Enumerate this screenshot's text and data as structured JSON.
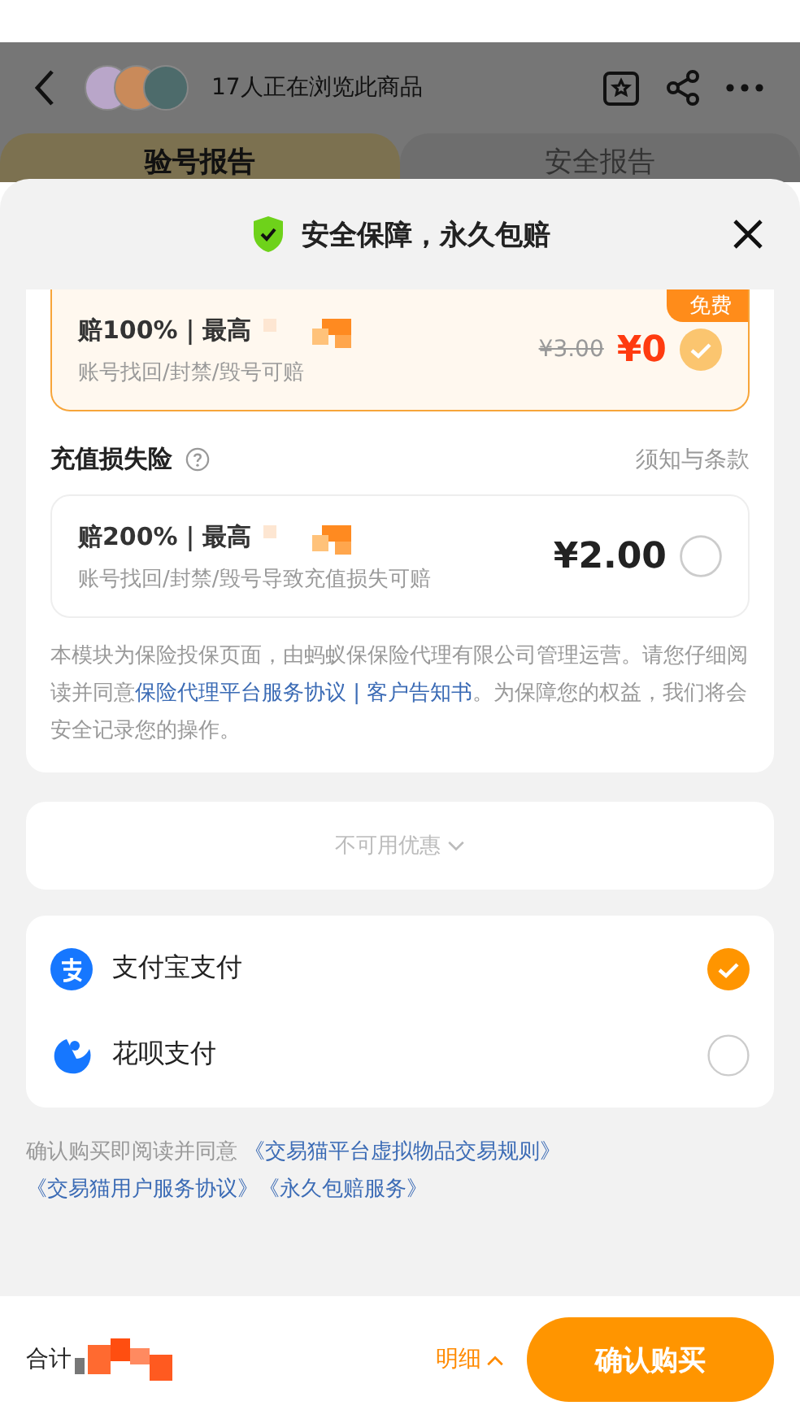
{
  "header": {
    "viewers": "17人正在浏览此商品"
  },
  "tabs": [
    {
      "label": "验号报告",
      "selected": true
    },
    {
      "label": "安全报告",
      "selected": false
    }
  ],
  "sheet": {
    "title": "安全保障，永久包赔"
  },
  "plans": [
    {
      "title": "赔100%｜最高",
      "desc": "账号找回/封禁/毁号可赔",
      "badge": "免费",
      "original_price": "¥3.00",
      "price": "¥0",
      "selected": true
    },
    {
      "title": "赔200%｜最高",
      "desc": "账号找回/封禁/毁号导致充值损失可赔",
      "price": "¥2.00",
      "selected": false
    }
  ],
  "section": {
    "title": "充值损失险",
    "terms_link": "须知与条款"
  },
  "notice": "本模块为保险投保页面，由蚂蚁保保险代理有限公司管理运营。请您仔细阅读并同意",
  "notice_link": "保险代理平台服务协议 | 客户告知书",
  "notice_tail": "。为保障您的权益，我们将会安全记录您的操作。",
  "coupon": "不可用优惠",
  "payments": [
    {
      "kind": "alipay",
      "label": "支付宝支付",
      "selected": true
    },
    {
      "kind": "huabei",
      "label": "花呗支付",
      "selected": false
    }
  ],
  "agreement": {
    "text": "确认购买即阅读并同意",
    "links": [
      "《交易猫平台虚拟物品交易规则》",
      "《交易猫用户服务协议》",
      "《永久包赔服务》"
    ]
  },
  "footer": {
    "total_label": "合计",
    "details": "明细",
    "confirm": "确认购买"
  }
}
